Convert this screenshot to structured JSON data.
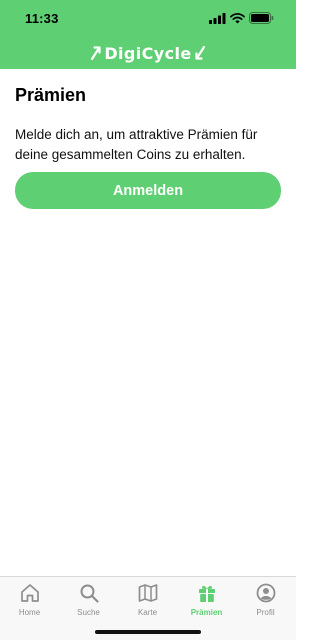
{
  "status": {
    "time": "11:33"
  },
  "header": {
    "app_name": "DigiCycle",
    "background": "#5fcf73",
    "left_icon": "arrow-up-right-icon",
    "right_icon": "arrow-down-left-icon"
  },
  "main": {
    "title": "Prämien",
    "text": "Melde dich an, um attraktive Prämien für deine gesammelten Coins zu erhalten.",
    "login_button": "Anmelden"
  },
  "tabs": [
    {
      "label": "Home",
      "icon": "home-icon",
      "active": false
    },
    {
      "label": "Suche",
      "icon": "search-icon",
      "active": false
    },
    {
      "label": "Karte",
      "icon": "map-icon",
      "active": false
    },
    {
      "label": "Prämien",
      "icon": "gift-icon",
      "active": true
    },
    {
      "label": "Profil",
      "icon": "profile-icon",
      "active": false
    }
  ],
  "colors": {
    "accent": "#5fcf73",
    "inactive_tab": "#8e8e8e"
  }
}
